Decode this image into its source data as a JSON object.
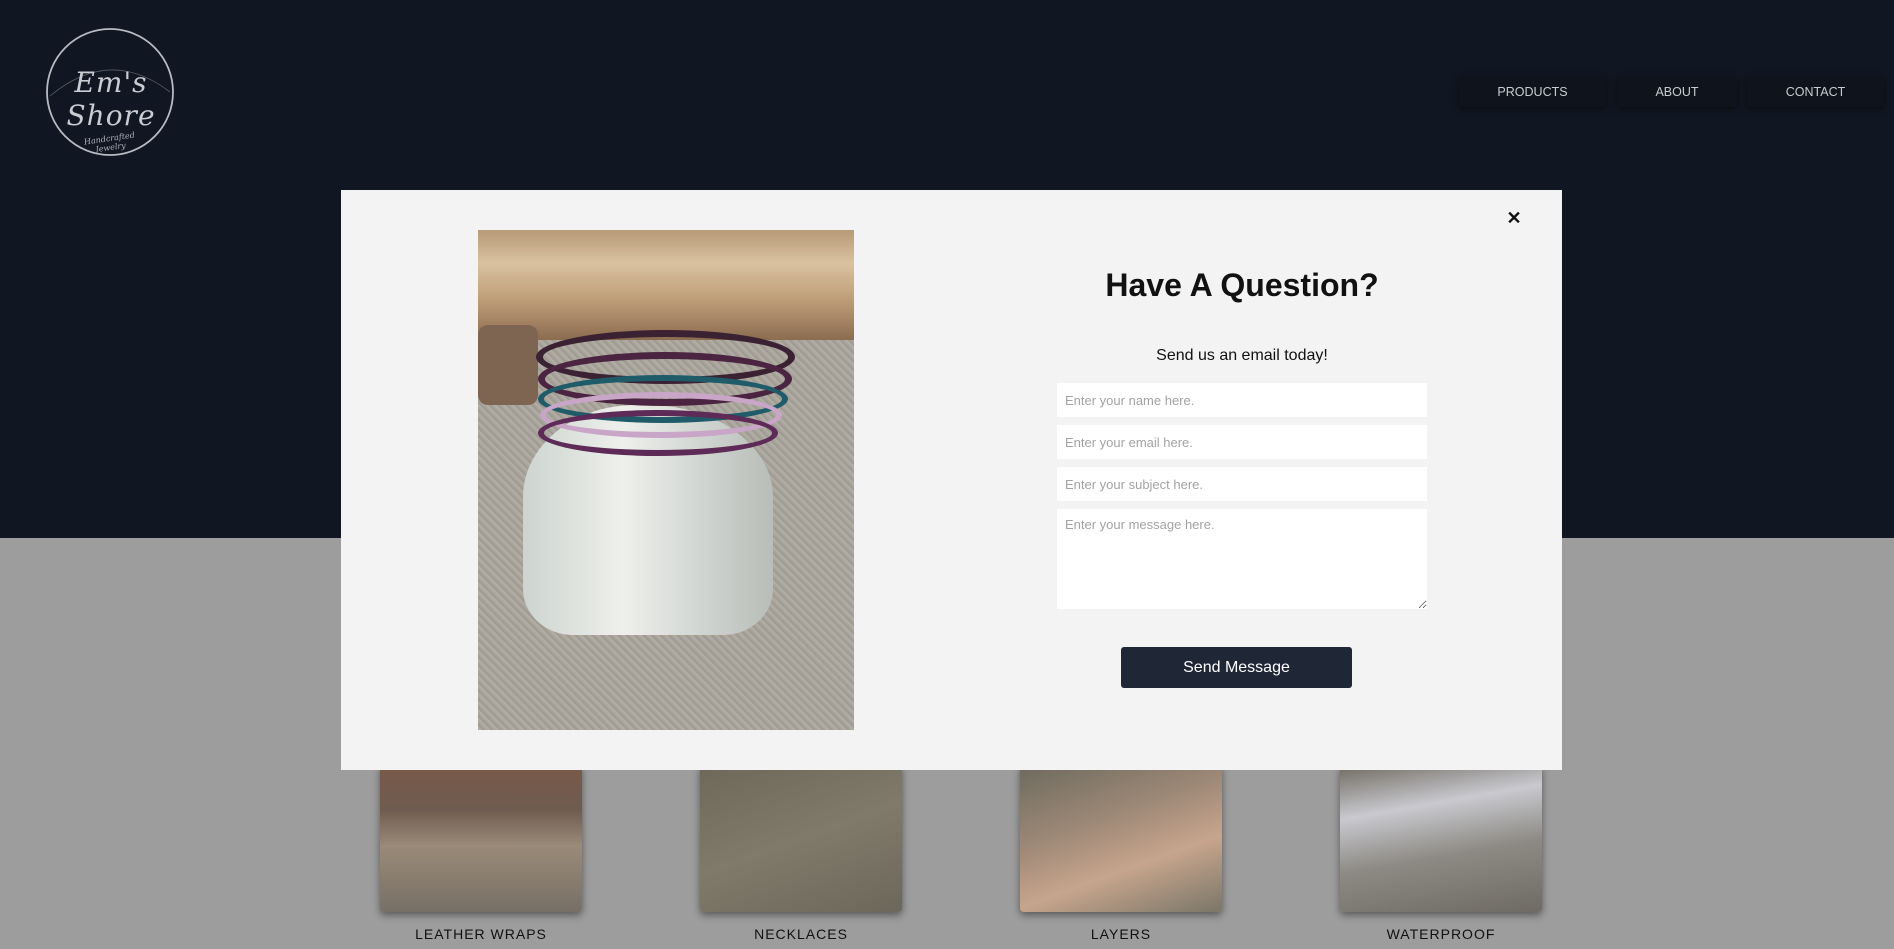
{
  "header": {
    "logo_text": "Em's Shore",
    "logo_subtext": "Handcrafted Jewelry",
    "nav": {
      "products": "PRODUCTS",
      "about": "ABOUT",
      "contact": "CONTACT"
    }
  },
  "categories": [
    {
      "label": "LEATHER WRAPS"
    },
    {
      "label": "NECKLACES"
    },
    {
      "label": "LAYERS"
    },
    {
      "label": "WATERPROOF"
    }
  ],
  "modal": {
    "close_glyph": "✕",
    "title": "Have A Question?",
    "subtitle": "Send us an email today!",
    "fields": {
      "name_placeholder": "Enter your name here.",
      "email_placeholder": "Enter your email here.",
      "subject_placeholder": "Enter your subject here.",
      "message_placeholder": "Enter your message here."
    },
    "send_label": "Send Message"
  },
  "colors": {
    "hero": "#111722",
    "button": "#1f2736",
    "modal_bg": "#f3f3f3"
  }
}
